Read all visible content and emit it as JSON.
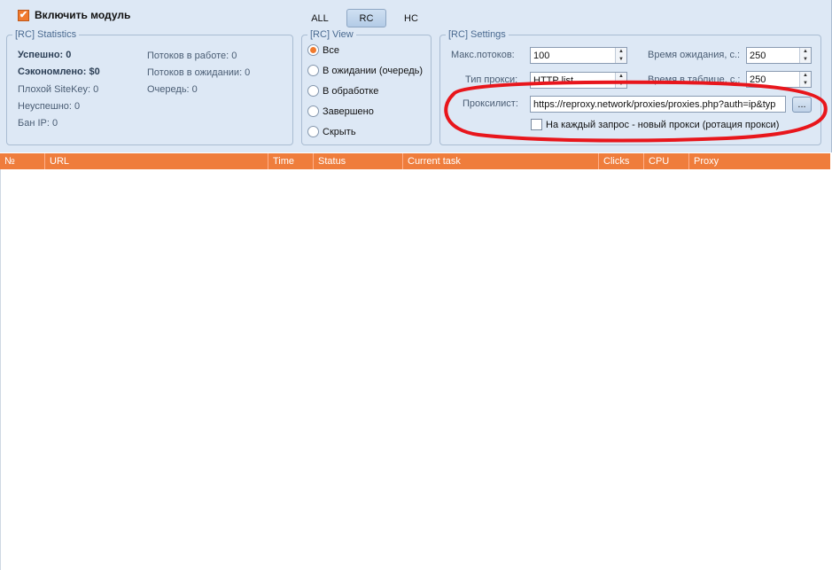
{
  "enable_module": {
    "label": "Включить модуль",
    "checked": true
  },
  "mode_tabs": [
    "ALL",
    "RC",
    "HC"
  ],
  "mode_selected": "RC",
  "statistics": {
    "legend": "[RC] Statistics",
    "success": "Успешно: 0",
    "saved": "Сэкономлено: $0",
    "bad_sitekey": "Плохой SiteKey: 0",
    "failed": "Неуспешно: 0",
    "ban_ip": "Бан IP: 0",
    "threads_working": "Потоков в работе: 0",
    "threads_waiting": "Потоков в ожидании: 0",
    "queue": "Очередь: 0"
  },
  "view": {
    "legend": "[RC] View",
    "options": [
      "Все",
      "В ожидании (очередь)",
      "В обработке",
      "Завершено",
      "Скрыть"
    ],
    "selected": "Все"
  },
  "settings": {
    "legend": "[RC] Settings",
    "max_threads_label": "Макс.потоков:",
    "max_threads_value": "100",
    "proxy_type_label": "Тип прокси:",
    "proxy_type_value": "HTTP list",
    "wait_time_label": "Время ожидания, с.:",
    "wait_time_value": "250",
    "table_time_label": "Время в таблице, с.:",
    "table_time_value": "250",
    "proxylist_label": "Проксилист:",
    "proxylist_value": "https://reproxy.network/proxies/proxies.php?auth=ip&typ",
    "browse_label": "...",
    "rotation_label": "На каждый запрос - новый прокси (ротация прокси)",
    "rotation_checked": false
  },
  "table": {
    "columns": [
      "№",
      "URL",
      "Time",
      "Status",
      "Current task",
      "Clicks",
      "CPU",
      "Proxy"
    ],
    "rows": []
  },
  "colors": {
    "accent": "#ef7d3c",
    "panel_background": "#dde8f5",
    "annotation": "#e8161c"
  }
}
